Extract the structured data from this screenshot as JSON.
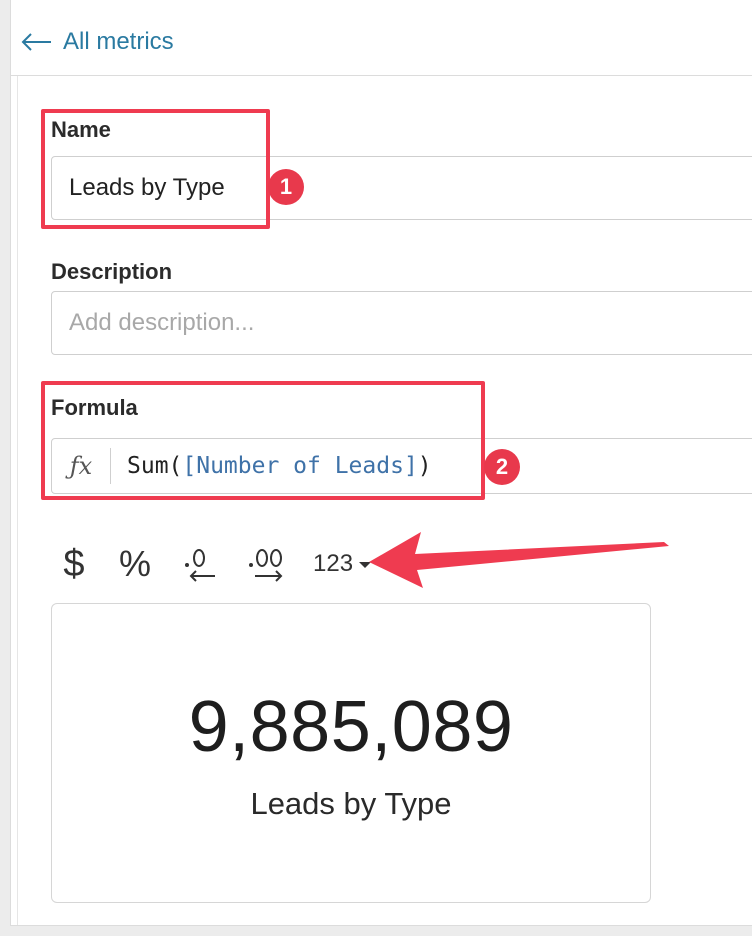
{
  "nav": {
    "back_label": "All metrics"
  },
  "name_field": {
    "label": "Name",
    "value": "Leads by Type"
  },
  "description_field": {
    "label": "Description",
    "placeholder": "Add description..."
  },
  "formula_field": {
    "label": "Formula",
    "fx_symbol": "ƒx",
    "func": "Sum(",
    "ref": "[Number of Leads]",
    "close": ")"
  },
  "format_toolbar": {
    "currency": "$",
    "percent": "%",
    "number_format": "123"
  },
  "preview": {
    "value": "9,885,089",
    "label": "Leads by Type"
  },
  "annotations": {
    "badge_1": "1",
    "badge_2": "2",
    "highlight_color": "#ef3b50"
  },
  "colors": {
    "link": "#2a7aa1",
    "formula_ref": "#3f72a8"
  }
}
